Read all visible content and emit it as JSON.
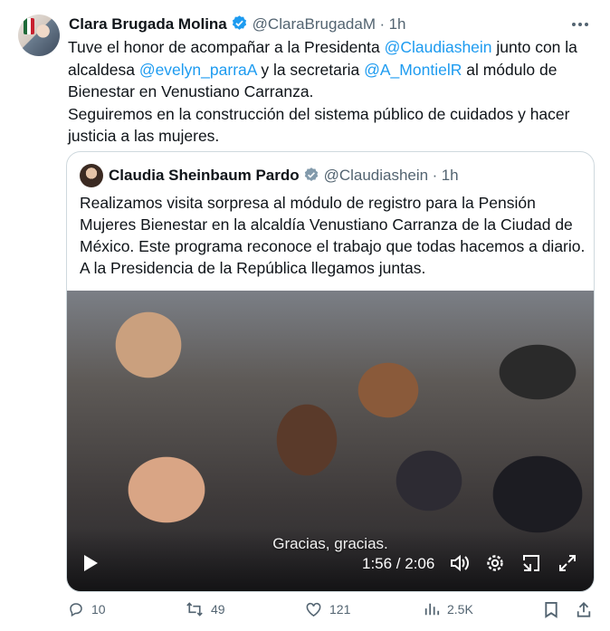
{
  "tweet": {
    "author_name": "Clara Brugada Molina",
    "handle": "@ClaraBrugadaM",
    "separator": "·",
    "time": "1h",
    "line1_a": "Tuve el honor de acompañar a la Presidenta ",
    "mention1": "@Claudiashein",
    "line1_b": " junto con la",
    "line2_a": "alcaldesa ",
    "mention2": "@evelyn_parraA",
    "line2_b": " y la secretaria ",
    "mention3": "@A_MontielR",
    "line2_c": " al módulo de",
    "line3": "Bienestar en Venustiano Carranza.",
    "line4": "Seguiremos en la construcción del sistema público de cuidados y hacer",
    "line5": "justicia a las mujeres."
  },
  "quote": {
    "author_name": "Claudia Sheinbaum Pardo",
    "handle": "@Claudiashein",
    "separator": "·",
    "time": "1h",
    "line1": "Realizamos visita sorpresa al módulo de registro para la Pensión",
    "line2": "Mujeres Bienestar en la alcaldía Venustiano Carranza de la Ciudad de",
    "line3": "México. Este programa reconoce el trabajo que todas hacemos a diario.",
    "line4": "A la Presidencia de la República llegamos juntas.",
    "video": {
      "caption": "Gracias, gracias.",
      "timecode": "1:56 / 2:06",
      "progress": 0.92
    }
  },
  "actions": {
    "replies": "10",
    "reposts": "49",
    "likes": "121",
    "views": "2.5K"
  },
  "icons": [
    "more-icon",
    "verified-icon",
    "play-icon",
    "volume-icon",
    "settings-icon",
    "pip-icon",
    "fullscreen-icon",
    "reply-icon",
    "repost-icon",
    "like-icon",
    "views-icon",
    "bookmark-icon",
    "share-icon"
  ],
  "colors": {
    "link": "#1d9bf0",
    "verified": "#1d9bf0",
    "muted": "#536471",
    "text": "#0f1419"
  }
}
